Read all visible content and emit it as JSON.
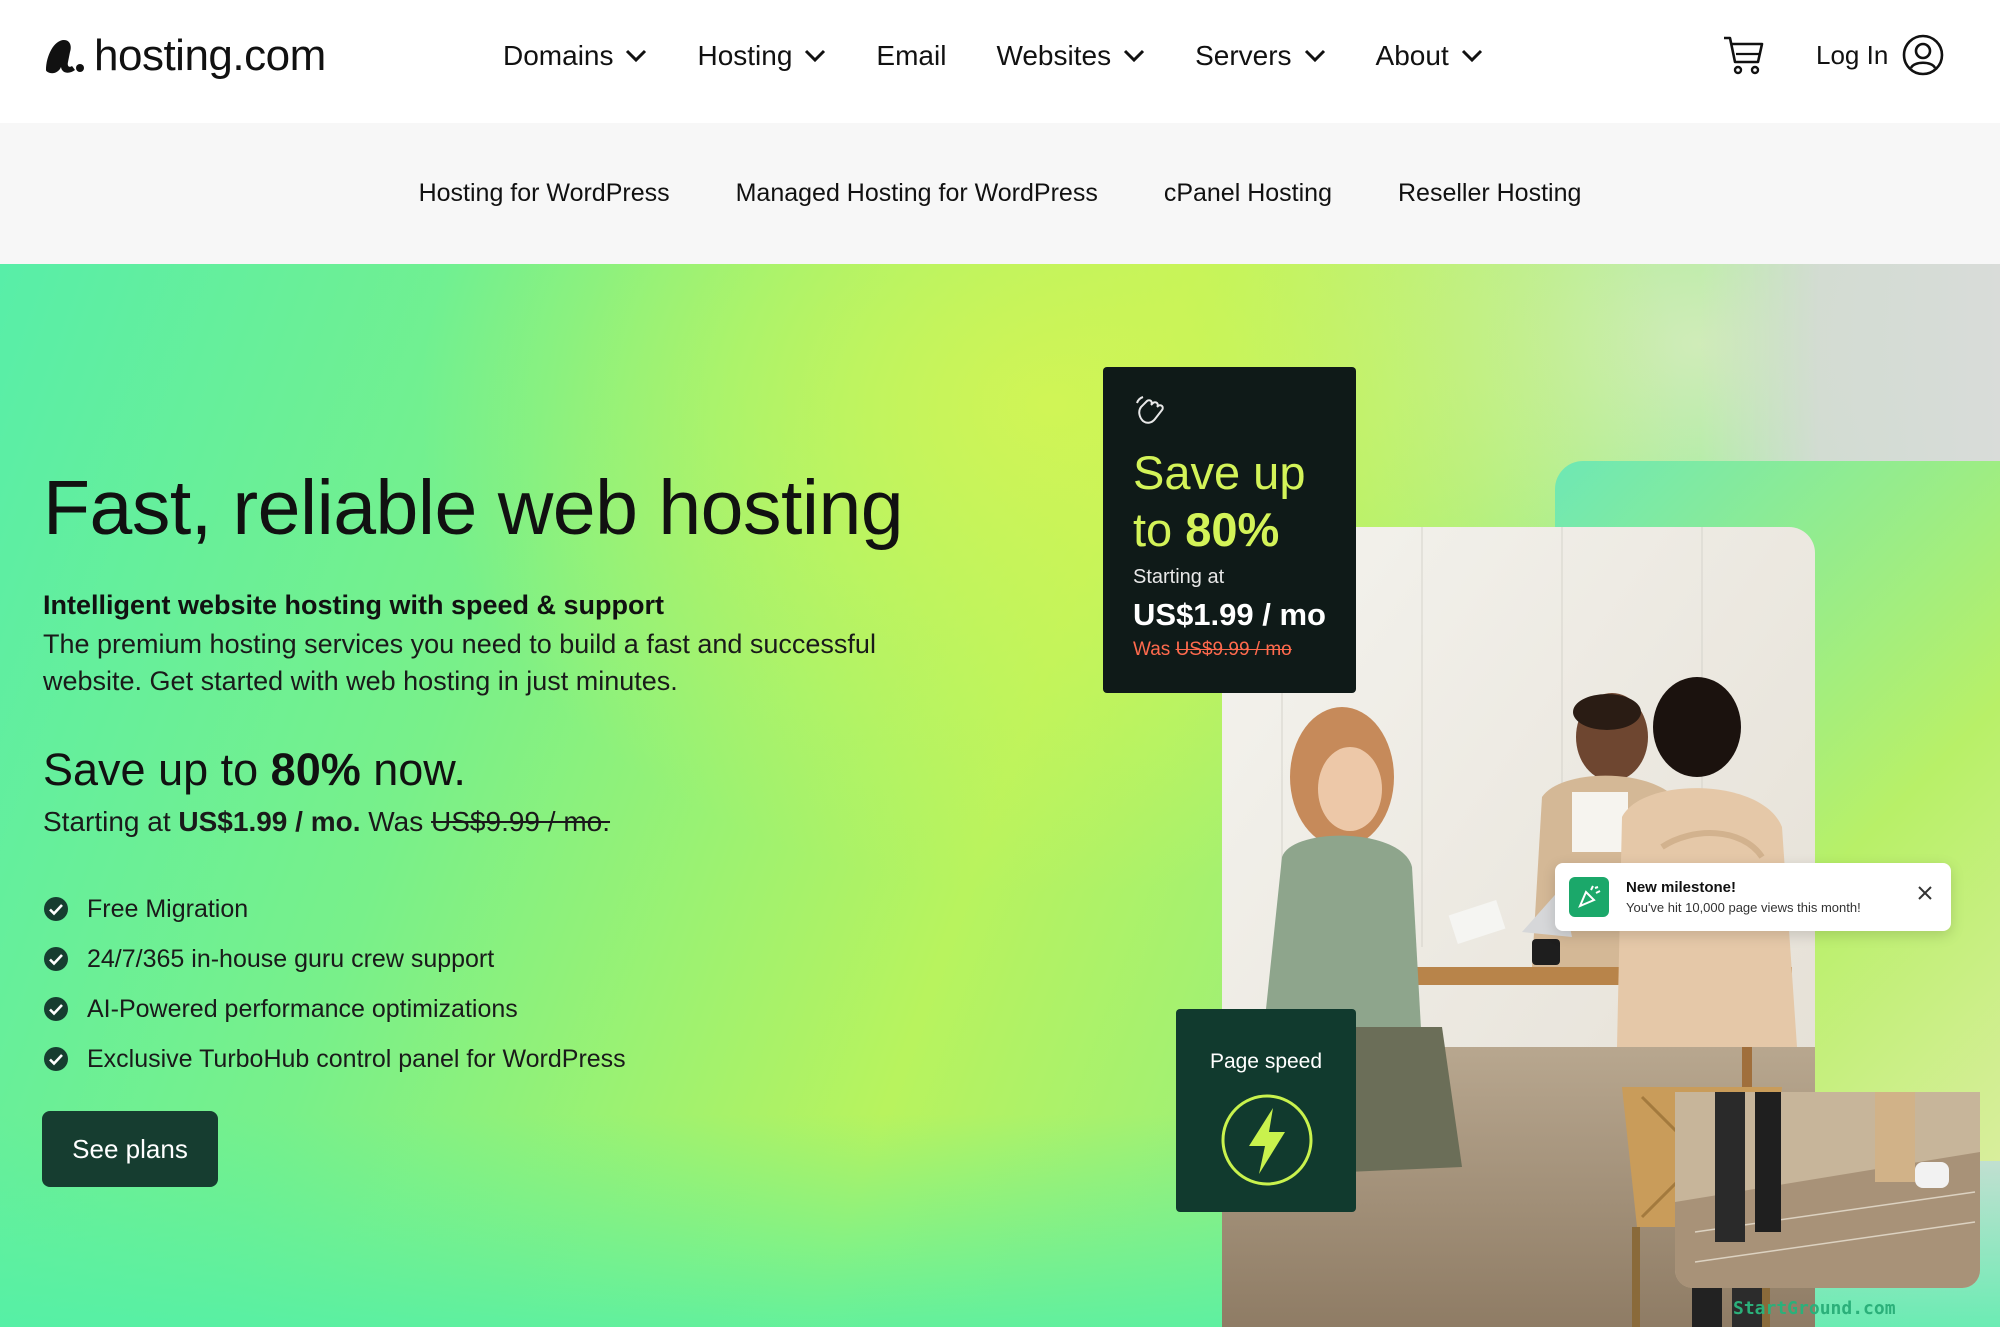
{
  "header": {
    "logo_text": "hosting.com",
    "nav": [
      {
        "label": "Domains",
        "has_dropdown": true
      },
      {
        "label": "Hosting",
        "has_dropdown": true
      },
      {
        "label": "Email",
        "has_dropdown": false
      },
      {
        "label": "Websites",
        "has_dropdown": true
      },
      {
        "label": "Servers",
        "has_dropdown": true
      },
      {
        "label": "About",
        "has_dropdown": true
      }
    ],
    "cart_icon": "cart-icon",
    "login_label": "Log In",
    "user_icon": "user-circle-icon"
  },
  "subnav": {
    "items": [
      "Hosting for WordPress",
      "Managed Hosting for WordPress",
      "cPanel Hosting",
      "Reseller Hosting"
    ]
  },
  "hero": {
    "title": "Fast, reliable web hosting",
    "subtitle_bold": "Intelligent website hosting with speed & support",
    "subtitle_text": "The premium hosting services you need to build a fast and successful website. Get started with web hosting in just minutes.",
    "save_prefix": "Save up to ",
    "save_percent": "80%",
    "save_suffix": " now.",
    "starting_prefix": "Starting at ",
    "starting_price": "US$1.99 / mo.",
    "was_label": " Was ",
    "was_price": "US$9.99 / mo.",
    "features": [
      "Free Migration",
      "24/7/365 in-house guru crew support",
      "AI-Powered performance optimizations",
      "Exclusive TurboHub control panel for WordPress"
    ],
    "cta_label": "See plans"
  },
  "promo_card": {
    "icon": "waving-hand-icon",
    "title_line1": "Save up",
    "title_line2_prefix": "to ",
    "title_percent": "80%",
    "starting_label": "Starting at",
    "price": "US$1.99 / mo",
    "was_label": "Was ",
    "was_price": "US$9.99 / mo"
  },
  "milestone_toast": {
    "icon": "party-popper-icon",
    "title": "New milestone!",
    "body": "You've hit 10,000 page views this month!"
  },
  "speed_card": {
    "label": "Page speed",
    "icon": "lightning-bolt-icon"
  },
  "watermark": "StartGround.com",
  "colors": {
    "brand_dark": "#163d30",
    "promo_bg": "#0f1a18",
    "promo_accent": "#d3f358",
    "was_red": "#ff6a4d",
    "hero_green": "#58eea8",
    "hero_lime": "#b8f35e"
  }
}
